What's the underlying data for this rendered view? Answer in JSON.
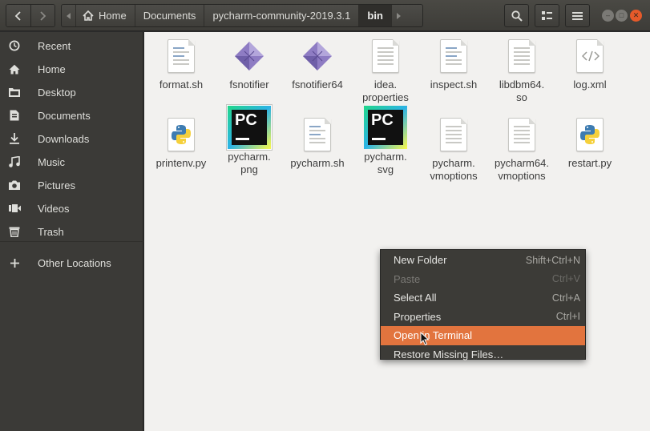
{
  "header": {
    "breadcrumbs": [
      "Home",
      "Documents",
      "pycharm-community-2019.3.1",
      "bin"
    ],
    "active_crumb": "bin"
  },
  "sidebar": {
    "items": [
      {
        "label": "Recent",
        "icon": "clock-icon"
      },
      {
        "label": "Home",
        "icon": "home-icon"
      },
      {
        "label": "Desktop",
        "icon": "folder-icon"
      },
      {
        "label": "Documents",
        "icon": "document-icon"
      },
      {
        "label": "Downloads",
        "icon": "download-icon"
      },
      {
        "label": "Music",
        "icon": "music-icon"
      },
      {
        "label": "Pictures",
        "icon": "camera-icon"
      },
      {
        "label": "Videos",
        "icon": "video-icon"
      },
      {
        "label": "Trash",
        "icon": "trash-icon"
      },
      {
        "label": "Other Locations",
        "icon": "plus-icon"
      }
    ]
  },
  "files": [
    {
      "name": "format.sh",
      "type": "script"
    },
    {
      "name": "fsnotifier",
      "type": "binary"
    },
    {
      "name": "fsnotifier64",
      "type": "binary"
    },
    {
      "name": "idea.\nproperties",
      "type": "text"
    },
    {
      "name": "inspect.sh",
      "type": "script"
    },
    {
      "name": "libdbm64.\nso",
      "type": "text"
    },
    {
      "name": "log.xml",
      "type": "xml"
    },
    {
      "name": "printenv.py",
      "type": "python"
    },
    {
      "name": "pycharm.\npng",
      "type": "pycharm"
    },
    {
      "name": "pycharm.sh",
      "type": "script"
    },
    {
      "name": "pycharm.\nsvg",
      "type": "pycharm"
    },
    {
      "name": "pycharm.\nvmoptions",
      "type": "text"
    },
    {
      "name": "pycharm64.\nvmoptions",
      "type": "text"
    },
    {
      "name": "restart.py",
      "type": "python"
    }
  ],
  "context_menu": {
    "items": [
      {
        "label": "New Folder",
        "shortcut": "Shift+Ctrl+N",
        "state": "normal"
      },
      {
        "label": "Paste",
        "shortcut": "Ctrl+V",
        "state": "disabled"
      },
      {
        "label": "Select All",
        "shortcut": "Ctrl+A",
        "state": "normal"
      },
      {
        "label": "Properties",
        "shortcut": "Ctrl+I",
        "state": "normal"
      },
      {
        "label": "Open in Terminal",
        "shortcut": "",
        "state": "selected"
      },
      {
        "label": "Restore Missing Files…",
        "shortcut": "",
        "state": "normal"
      }
    ]
  },
  "colors": {
    "accent": "#e2743e",
    "sidebar": "#3b3a37",
    "content": "#f2f1ef"
  }
}
